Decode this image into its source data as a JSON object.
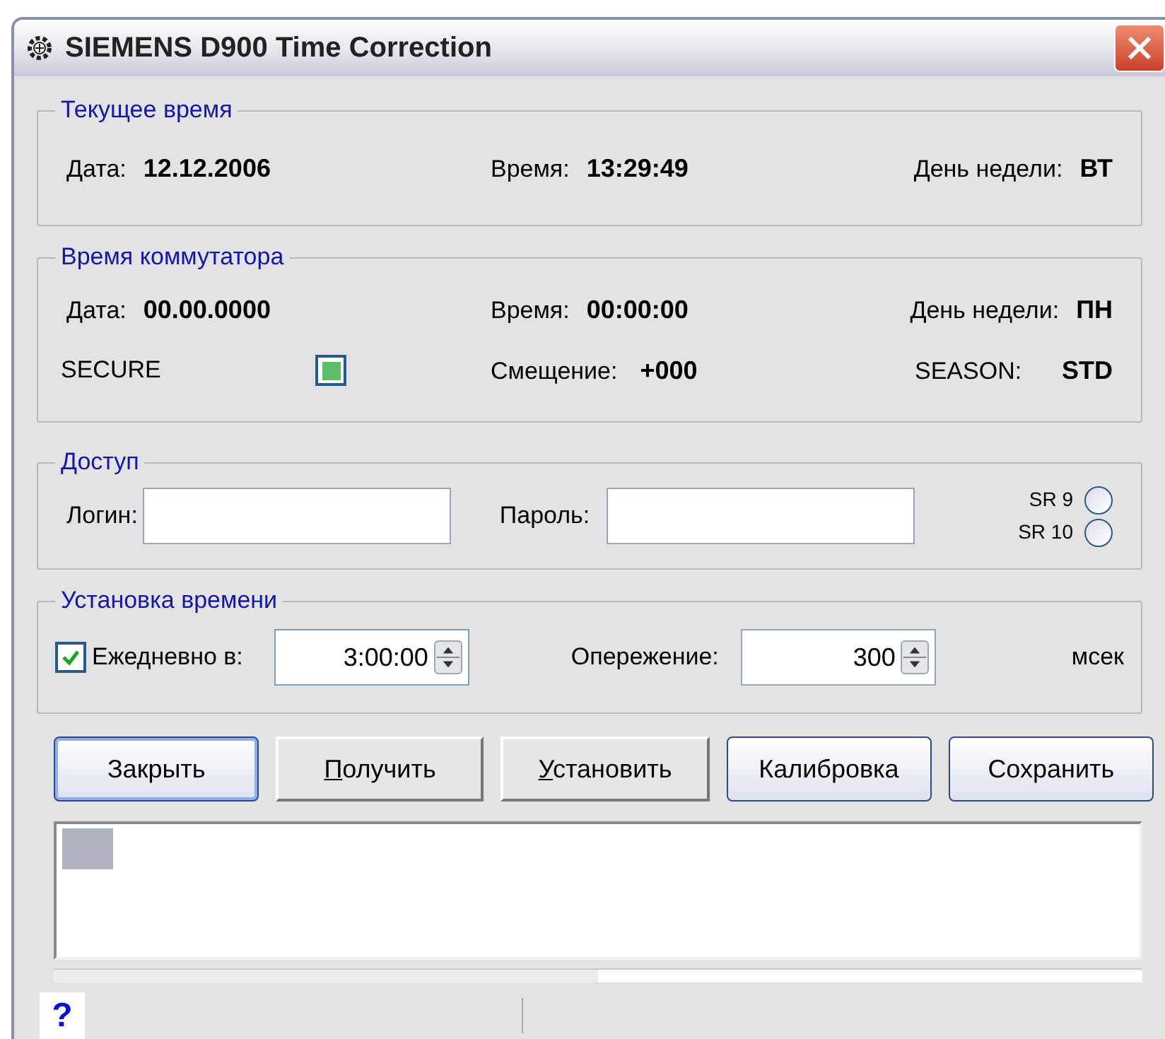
{
  "window": {
    "title": "SIEMENS D900 Time Correction"
  },
  "current_time": {
    "title": "Текущее время",
    "fields": [
      {
        "label": "Дата:",
        "value": "12.12.2006"
      },
      {
        "label": "Время:",
        "value": "13:29:49"
      },
      {
        "label": "День недели:",
        "value": "ВТ"
      }
    ]
  },
  "switch_time": {
    "title": "Время коммутатора",
    "fields": [
      {
        "label": "Дата:",
        "value": "00.00.0000"
      },
      {
        "label": "Время:",
        "value": "00:00:00"
      },
      {
        "label": "День недели:",
        "value": "ПН"
      }
    ],
    "secure": {
      "label": "SECURE",
      "on": true
    },
    "offset": {
      "label": "Смещение:",
      "value": "+000"
    },
    "season": {
      "label": "SEASON:",
      "value": "STD"
    }
  },
  "access": {
    "title": "Доступ",
    "login": {
      "label": "Логин:"
    },
    "password": {
      "label": "Пароль:"
    },
    "versions": [
      {
        "label": "SR 9",
        "selected": false
      },
      {
        "label": "SR 10",
        "selected": false
      }
    ]
  },
  "time_setting": {
    "title": "Установка времени",
    "daily": {
      "label": "Ежедневно в:",
      "checked": true,
      "value": "3:00:00"
    },
    "advance": {
      "label": "Опережение:",
      "value": "300",
      "unit": "мсек"
    }
  },
  "buttons": [
    {
      "label": "Закрыть",
      "kind": "themed",
      "underline_first": false
    },
    {
      "label": "Получить",
      "kind": "classic",
      "underline_first": true
    },
    {
      "label": "Установить",
      "kind": "classic",
      "underline_first": true
    },
    {
      "label": "Калибровка",
      "kind": "themed",
      "underline_first": false
    },
    {
      "label": "Сохранить",
      "kind": "themed",
      "underline_first": false
    }
  ],
  "progress": {
    "level": 0.5
  },
  "status_bar": {
    "help": "?"
  }
}
